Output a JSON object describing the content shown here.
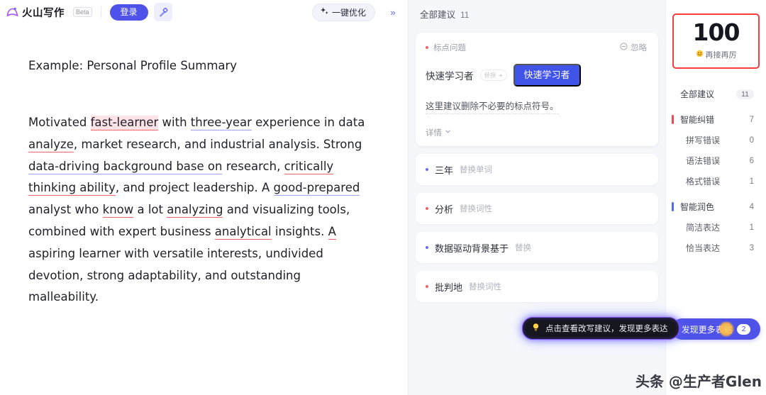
{
  "header": {
    "logo_text": "火山写作",
    "beta_label": "Beta",
    "login_label": "登录",
    "wand_icon": "magic-wand-icon",
    "optimize_label": "一键优化",
    "sparkle_icon": "sparkle-icon",
    "collapse_icon": "double-chevron-right-icon"
  },
  "document": {
    "title": "Example: Personal Profile Summary",
    "segments": [
      {
        "text": "Motivated ",
        "mark": "none"
      },
      {
        "text": "fast-learner",
        "mark": "red-highlight"
      },
      {
        "text": " with ",
        "mark": "none"
      },
      {
        "text": "three-year",
        "mark": "blue"
      },
      {
        "text": " experience in data ",
        "mark": "none"
      },
      {
        "text": "analyze",
        "mark": "red"
      },
      {
        "text": ", market research, and industrial analysis. Strong ",
        "mark": "none"
      },
      {
        "text": "data-driving background base on",
        "mark": "blue"
      },
      {
        "text": " research, ",
        "mark": "none"
      },
      {
        "text": "critically thinking ability",
        "mark": "red"
      },
      {
        "text": ", and project leadership. A ",
        "mark": "none"
      },
      {
        "text": "good-prepared",
        "mark": "blue"
      },
      {
        "text": " analyst who ",
        "mark": "none"
      },
      {
        "text": "know",
        "mark": "red"
      },
      {
        "text": " a lot ",
        "mark": "none"
      },
      {
        "text": "analyzing",
        "mark": "red"
      },
      {
        "text": " and visualizing tools, combined with expert business ",
        "mark": "none"
      },
      {
        "text": "analytical",
        "mark": "red"
      },
      {
        "text": " insights. ",
        "mark": "none"
      },
      {
        "text": "A",
        "mark": "red"
      },
      {
        "text": " aspiring learner with versatile interests, undivided devotion, strong adaptability, and outstanding malleability.",
        "mark": "none"
      }
    ]
  },
  "suggestions": {
    "header_label": "全部建议",
    "header_count": "11",
    "card": {
      "type_label": "标点问题",
      "ignore_label": "忽略",
      "ignore_icon": "minus-circle-icon",
      "old_text": "快速学习者",
      "arrow_icon": "arrow-right-icon",
      "arrow_glyph": "替换",
      "new_text": "快速学习者",
      "description": "这里建议删除不必要的标点符号。",
      "more_label": "详情",
      "more_icon": "chevron-down-icon"
    },
    "rows": [
      {
        "word": "三年",
        "kind": "替换单词",
        "dot": "blue"
      },
      {
        "word": "分析",
        "kind": "替换词性",
        "dot": "red"
      },
      {
        "word": "数据驱动背景基于",
        "kind": "替换",
        "dot": "blue"
      },
      {
        "word": "批判地",
        "kind": "替换词性",
        "dot": "red"
      }
    ],
    "tooltip": {
      "icon": "lightbulb-icon",
      "text": "点击查看改写建议，发现更多表达"
    }
  },
  "sidebar": {
    "score": {
      "value": "100",
      "emoji": "grinning-face-icon",
      "caption": "再接再厉"
    },
    "nav": [
      {
        "label": "全部建议",
        "count": "11",
        "level": "all",
        "bar": "none"
      },
      {
        "label": "智能纠错",
        "count": "7",
        "level": "group",
        "bar": "red"
      },
      {
        "label": "拼写错误",
        "count": "0",
        "level": "sub",
        "bar": "none"
      },
      {
        "label": "语法错误",
        "count": "6",
        "level": "sub",
        "bar": "none"
      },
      {
        "label": "格式错误",
        "count": "1",
        "level": "sub",
        "bar": "none"
      },
      {
        "label": "智能润色",
        "count": "4",
        "level": "group",
        "bar": "blue"
      },
      {
        "label": "简洁表达",
        "count": "1",
        "level": "sub",
        "bar": "none"
      },
      {
        "label": "恰当表达",
        "count": "3",
        "level": "sub",
        "bar": "none"
      }
    ],
    "discover": {
      "label": "发现更多表达",
      "count": "2"
    }
  },
  "watermark": {
    "text": "头条 @生产者Glen"
  },
  "colors": {
    "brand_purple": "#4f52e8",
    "accent_blue": "#4054ea",
    "error_red": "#f0636b",
    "score_border": "#f83b3b",
    "panel_bg": "#f6f7fb"
  }
}
